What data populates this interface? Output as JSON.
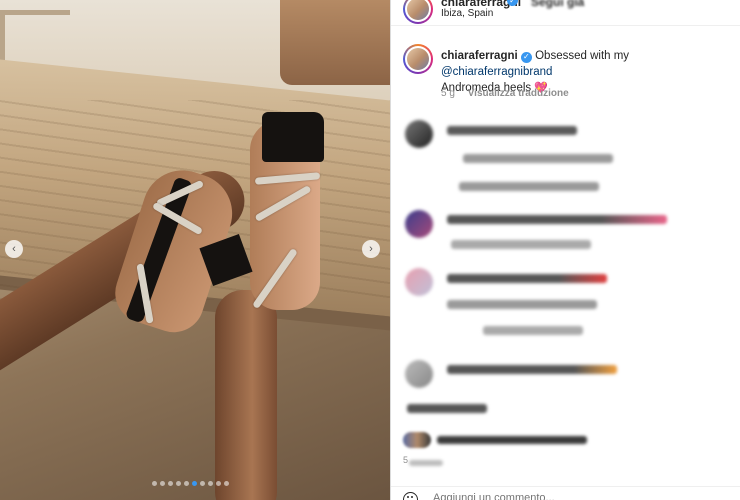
{
  "post": {
    "username": "chiaraferragni",
    "location": "Ibiza, Spain",
    "follow_label": "Segui già",
    "caption_username": "chiaraferragni",
    "caption_prefix": "Obsessed with my",
    "caption_mention": "@chiaraferragnibrand",
    "caption_suffix": "Andromeda heels",
    "caption_emoji": "💖",
    "time_ago": "5 g",
    "translate_label": "Visualizza traduzione"
  },
  "media": {
    "carousel_dots": 10,
    "active_dot_index": 5,
    "prev_arrow": "‹",
    "next_arrow": "›"
  },
  "footer": {
    "likes_time_label": "5",
    "add_comment_placeholder": "Aggiungi un commento..."
  },
  "icons": {
    "verified": "verified-badge-icon",
    "emoji": "emoji-icon",
    "heart": "heart-emoji"
  },
  "colors": {
    "verified_blue": "#3897f0",
    "mention_blue": "#00376b",
    "muted_gray": "#8e8e8e",
    "active_dot": "#3897f0"
  }
}
